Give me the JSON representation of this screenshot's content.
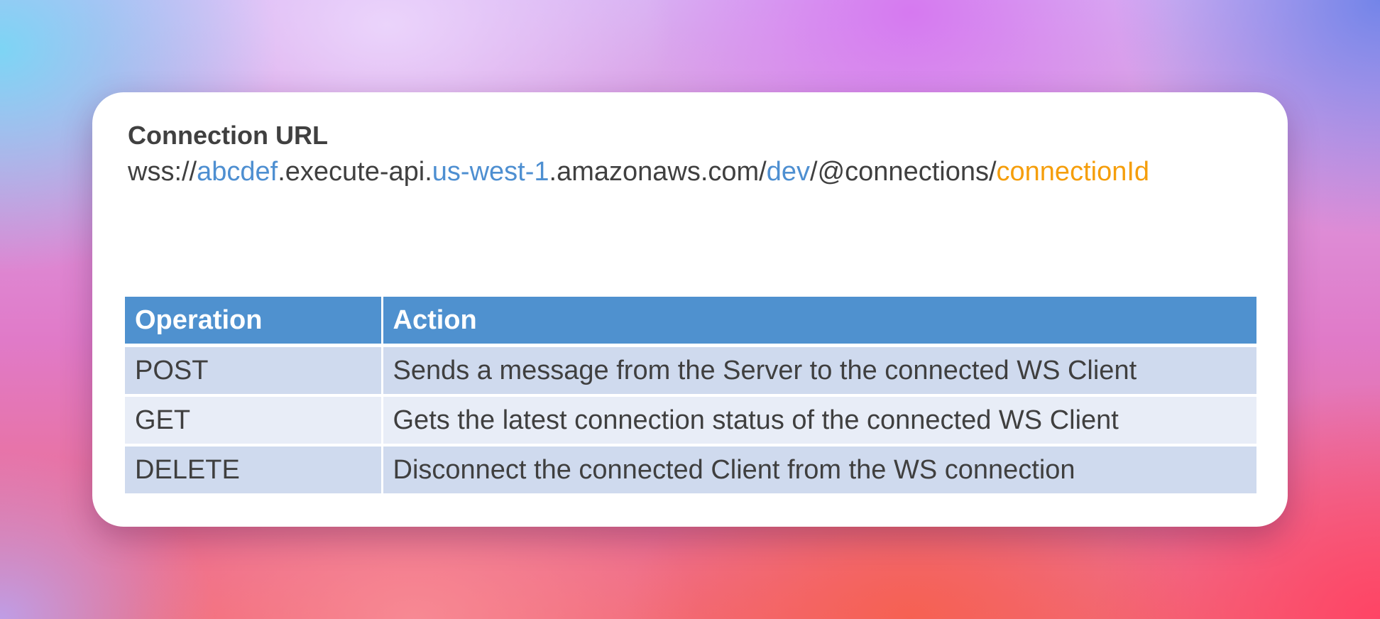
{
  "url": {
    "title": "Connection URL",
    "segments": [
      {
        "text": "wss://",
        "color": "#404040"
      },
      {
        "text": "abcdef",
        "color": "#4e8fd1"
      },
      {
        "text": ".execute-api.",
        "color": "#404040"
      },
      {
        "text": "us-west-1",
        "color": "#4e8fd1"
      },
      {
        "text": ".amazonaws.com/",
        "color": "#404040"
      },
      {
        "text": "dev",
        "color": "#4e8fd1"
      },
      {
        "text": "/@connections/",
        "color": "#404040"
      },
      {
        "text": "connectionId",
        "color": "#f59e0b"
      }
    ]
  },
  "table": {
    "headers": [
      "Operation",
      "Action"
    ],
    "header_color": "#4f91cf",
    "rows": [
      {
        "operation": "POST",
        "action": "Sends a message from the Server to the connected WS Client"
      },
      {
        "operation": "GET",
        "action": "Gets the latest connection status of the connected WS Client"
      },
      {
        "operation": "DELETE",
        "action": "Disconnect the connected Client from the WS connection"
      }
    ]
  }
}
